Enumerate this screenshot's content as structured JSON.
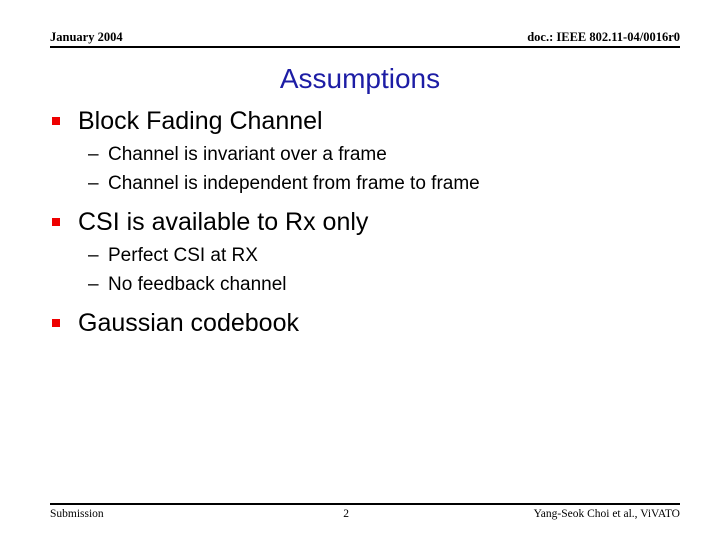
{
  "header": {
    "left": "January 2004",
    "right": "doc.: IEEE 802.11-04/0016r0"
  },
  "title": "Assumptions",
  "colors": {
    "title_blue": "#1d1da5",
    "bullet_red": "#ee0000",
    "text_black": "#000000",
    "background": "#ffffff"
  },
  "body": {
    "bullets": [
      {
        "marker": "square-bullet",
        "text": "Block Fading Channel",
        "sub": [
          {
            "marker": "en-dash",
            "text": "Channel is invariant over a frame"
          },
          {
            "marker": "en-dash",
            "text": "Channel is independent from frame to frame"
          }
        ]
      },
      {
        "marker": "square-bullet",
        "text": "CSI is available to Rx only",
        "sub": [
          {
            "marker": "en-dash",
            "text": "Perfect CSI at RX"
          },
          {
            "marker": "en-dash",
            "text": "No feedback channel"
          }
        ]
      },
      {
        "marker": "square-bullet",
        "text": "Gaussian codebook",
        "sub": []
      }
    ]
  },
  "footer": {
    "left": "Submission",
    "page": "2",
    "right": "Yang-Seok Choi et al., ViVATO"
  }
}
